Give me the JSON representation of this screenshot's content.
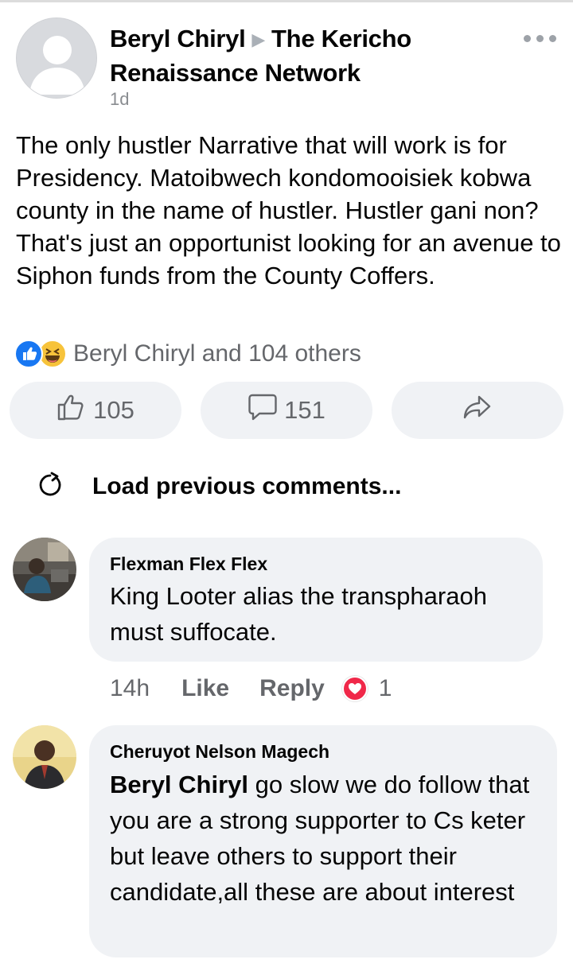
{
  "post": {
    "author": "Beryl Chiryl",
    "group": "The Kericho Renaissance Network",
    "time": "1d",
    "text": "The only hustler Narrative that will work is for Presidency. Matoibwech kondomooisiek kobwa county in the name of hustler. Hustler gani non? That's just an opportunist looking for an avenue to  Siphon funds from the County Coffers.",
    "reactions_summary": "Beryl Chiryl and 104 others",
    "reaction_icons": [
      "like-icon",
      "haha-icon"
    ],
    "like_count": "105",
    "comment_count": "151"
  },
  "load_previous": "Load previous comments...",
  "comments": [
    {
      "author": "Flexman Flex Flex",
      "text": "King Looter alias the transpharaoh must suffocate.",
      "time": "14h",
      "like_label": "Like",
      "reply_label": "Reply",
      "reaction_icon": "love-icon",
      "reaction_count": "1"
    },
    {
      "author": "Cheruyot Nelson Magech",
      "mention": "Beryl Chiryl",
      "text": " go slow we do follow that you are a strong supporter to Cs keter but leave others to support their candidate,all these are about interest"
    }
  ],
  "colors": {
    "bubble": "#f0f2f5",
    "secondary_text": "#65676b",
    "like_blue": "#1877f2",
    "love_red": "#f02849"
  }
}
